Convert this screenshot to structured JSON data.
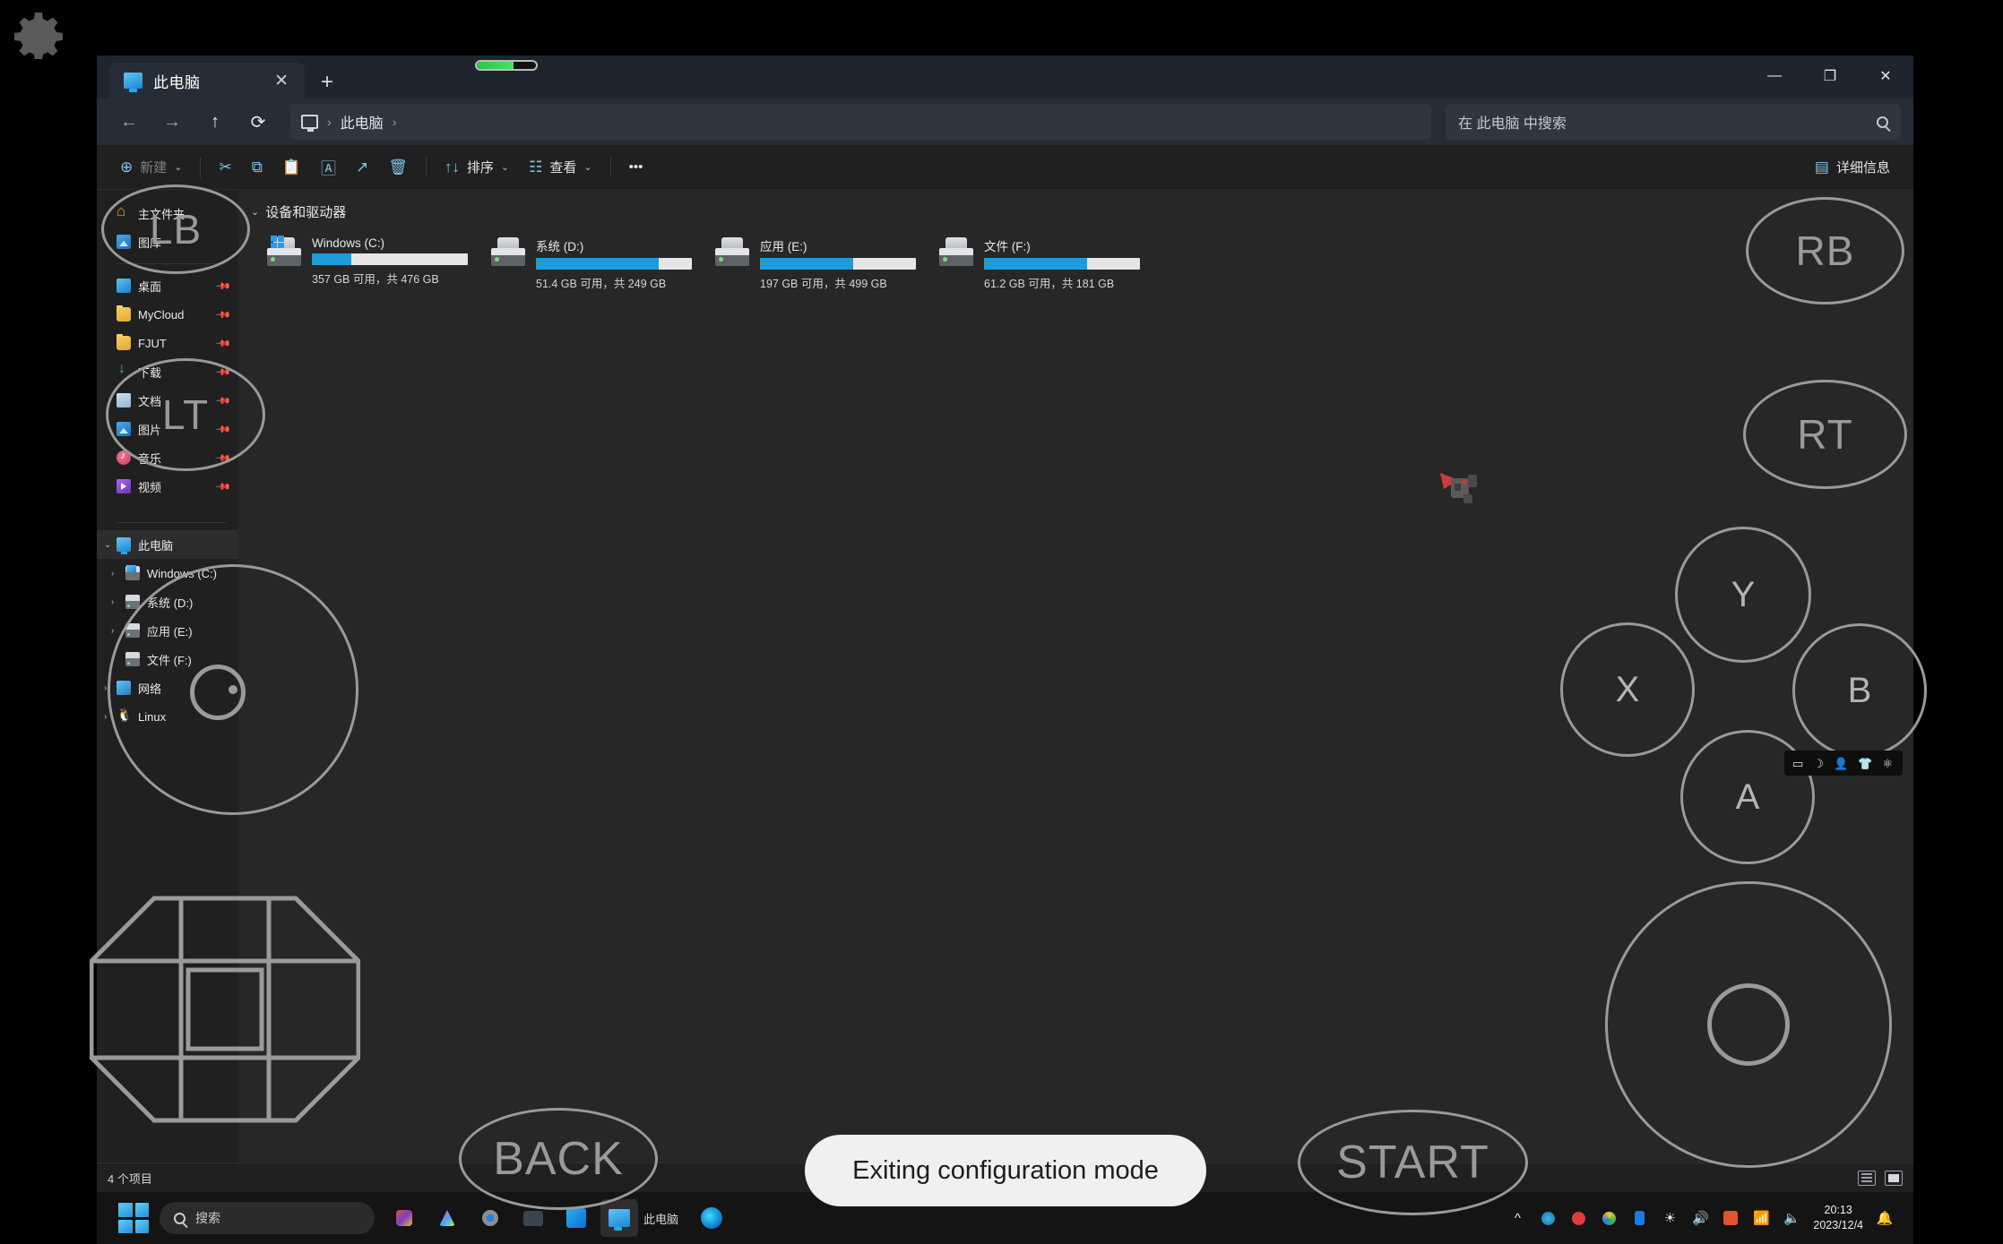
{
  "window": {
    "tab": {
      "title": "此电脑",
      "close_label": "✕",
      "new_tab_label": "+"
    },
    "controls": {
      "minimize": "—",
      "maximize": "❐",
      "close": "✕"
    },
    "nav": {
      "back": "←",
      "forward": "→",
      "up": "↑",
      "refresh": "⟳"
    },
    "breadcrumb": {
      "root_icon": "monitor-icon",
      "sep1": "›",
      "path": "此电脑",
      "sep2": "›"
    },
    "search": {
      "placeholder": "在 此电脑 中搜索",
      "icon": "search-icon"
    },
    "commandbar": {
      "new_label": "新建",
      "new_caret": "⌄",
      "cut": "✂",
      "copy": "⧉",
      "paste": "📋",
      "rename": "🄰",
      "share": "↗",
      "delete": "🗑",
      "sort_label": "排序",
      "sort_caret": "⌄",
      "view_label": "查看",
      "view_caret": "⌄",
      "more": "•••",
      "details_label": "详细信息"
    },
    "sidebar": {
      "quick": [
        {
          "label": "主文件夹",
          "icon": "home-icon",
          "pinned": false
        },
        {
          "label": "图库",
          "icon": "gallery-icon",
          "pinned": false
        }
      ],
      "pinned": [
        {
          "label": "桌面",
          "icon": "desktop-icon",
          "pinned": true
        },
        {
          "label": "MyCloud",
          "icon": "folder-icon",
          "pinned": true
        },
        {
          "label": "FJUT",
          "icon": "folder-icon",
          "pinned": true
        },
        {
          "label": "下载",
          "icon": "downloads-icon",
          "pinned": true
        },
        {
          "label": "文档",
          "icon": "documents-icon",
          "pinned": true
        },
        {
          "label": "图片",
          "icon": "pictures-icon",
          "pinned": true
        },
        {
          "label": "音乐",
          "icon": "music-icon",
          "pinned": true
        },
        {
          "label": "视频",
          "icon": "videos-icon",
          "pinned": true
        }
      ],
      "tree": [
        {
          "label": "此电脑",
          "icon": "this-pc-icon",
          "chevron": "⌄",
          "selected": true,
          "indent": 0
        },
        {
          "label": "Windows (C:)",
          "icon": "windows-drive-icon",
          "chevron": "›",
          "selected": false,
          "indent": 1
        },
        {
          "label": "系统 (D:)",
          "icon": "drive-icon",
          "chevron": "›",
          "selected": false,
          "indent": 1
        },
        {
          "label": "应用 (E:)",
          "icon": "drive-icon",
          "chevron": "›",
          "selected": false,
          "indent": 1
        },
        {
          "label": "文件 (F:)",
          "icon": "drive-icon",
          "chevron": "›",
          "selected": false,
          "indent": 1
        },
        {
          "label": "网络",
          "icon": "network-icon",
          "chevron": "›",
          "selected": false,
          "indent": 0
        },
        {
          "label": "Linux",
          "icon": "linux-icon",
          "chevron": "›",
          "selected": false,
          "indent": 0
        }
      ]
    },
    "content": {
      "group_chevron": "⌄",
      "group_title": "设备和驱动器",
      "drives": [
        {
          "name": "Windows (C:)",
          "free_text": "357 GB 可用，共 476 GB",
          "used_pct": 25,
          "is_system": true
        },
        {
          "name": "系统 (D:)",
          "free_text": "51.4 GB 可用，共 249 GB",
          "used_pct": 79,
          "is_system": false
        },
        {
          "name": "应用 (E:)",
          "free_text": "197 GB 可用，共 499 GB",
          "used_pct": 60,
          "is_system": false
        },
        {
          "name": "文件 (F:)",
          "free_text": "61.2 GB 可用，共 181 GB",
          "used_pct": 66,
          "is_system": false
        }
      ]
    },
    "statusbar": {
      "count_text": "4 个项目",
      "view_list": "list-view-icon",
      "view_tile": "tile-view-icon"
    }
  },
  "taskbar": {
    "start_icon": "windows-start-icon",
    "search": {
      "placeholder": "搜索",
      "icon": "search-icon"
    },
    "apps": [
      {
        "name": "office-icon"
      },
      {
        "name": "adobe-icon"
      },
      {
        "name": "settings-gear-icon"
      },
      {
        "name": "terminal-icon"
      },
      {
        "name": "store-icon"
      },
      {
        "name": "file-explorer-icon",
        "label": "此电脑",
        "active": true
      },
      {
        "name": "edge-dev-icon"
      }
    ],
    "tray": {
      "overflow": "^",
      "icons": [
        "sync-icon",
        "monitor-health-icon",
        "drive-guard-icon",
        "bluetooth-icon",
        "brightness-icon",
        "volume-icon",
        "snipaste-icon",
        "wifi-icon",
        "speaker-icon"
      ],
      "time": "20:13",
      "date": "2023/12/4",
      "notification": "bell-icon"
    }
  },
  "overlay": {
    "gear": "settings-gear-icon",
    "battery_pct": 62,
    "buttons": {
      "lb": "LB",
      "lt": "LT",
      "rb": "RB",
      "rt": "RT",
      "y": "Y",
      "x": "X",
      "b": "B",
      "a": "A",
      "back": "BACK",
      "start": "START"
    },
    "left_stick": "left-analog-stick",
    "right_stick": "right-analog-stick",
    "dpad": "d-pad",
    "toast": "Exiting configuration mode"
  },
  "minibar": {
    "icons": [
      "window-icon",
      "moon-icon",
      "person-icon",
      "shirt-icon",
      "atom-icon"
    ]
  }
}
